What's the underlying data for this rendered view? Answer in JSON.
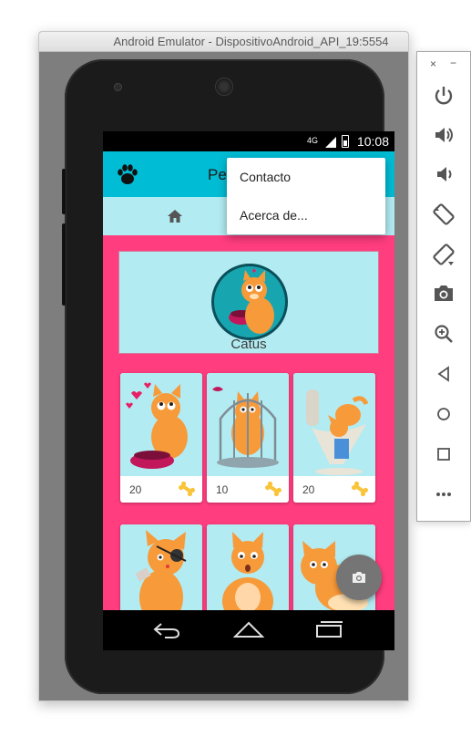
{
  "emulator": {
    "title": "Android Emulator - DispositivoAndroid_API_19:5554"
  },
  "statusbar": {
    "network_label": "4G",
    "time": "10:08"
  },
  "app": {
    "title": "Pe",
    "menu_items": [
      "Contacto",
      "Acerca de..."
    ]
  },
  "profile": {
    "name": "Catus"
  },
  "pets": [
    {
      "count": "20",
      "icon": "bone-icon"
    },
    {
      "count": "10",
      "icon": "bone-icon"
    },
    {
      "count": "20",
      "icon": "bone-icon"
    }
  ],
  "colors": {
    "toolbar": "#00bcd4",
    "nav_strip": "#b2ebf2",
    "background": "#ff3d7f",
    "bone": "#f9c43a",
    "fab": "#757575"
  },
  "side_toolbar": {
    "window_controls": [
      "×",
      "−"
    ],
    "tools": [
      "power-icon",
      "volume-up-icon",
      "volume-down-icon",
      "rotate-left-icon",
      "rotate-right-icon",
      "screenshot-icon",
      "zoom-icon",
      "back-icon",
      "home-icon",
      "overview-icon",
      "more-icon"
    ]
  }
}
